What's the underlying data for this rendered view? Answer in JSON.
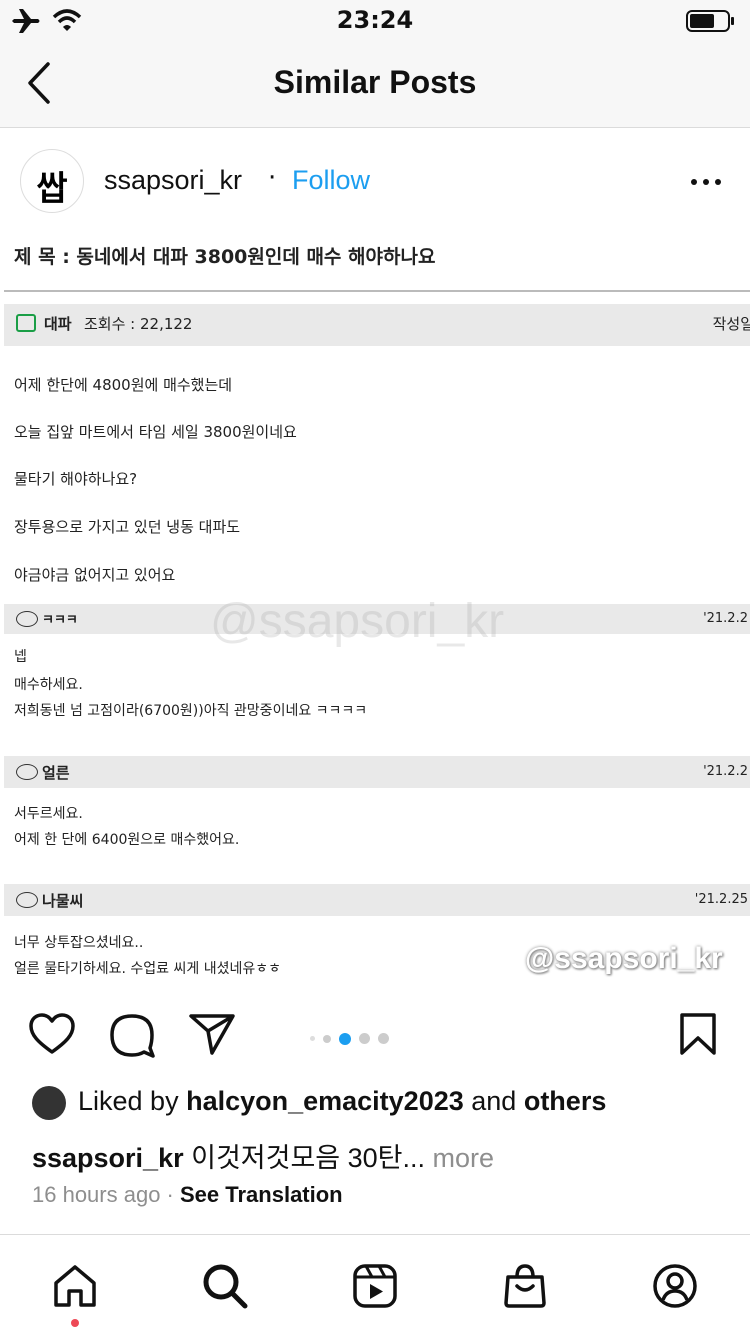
{
  "status_bar": {
    "time": "23:24"
  },
  "nav": {
    "title": "Similar Posts"
  },
  "post": {
    "avatar_text": "쌉",
    "username": "ssapsori_kr",
    "separator": "·",
    "follow": "Follow",
    "image": {
      "subject": "제 목 : 동네에서 대파 3800원인데 매수 해야하나요",
      "category": "대파",
      "views": "조회수 : 22,122",
      "written": "작성일",
      "body": [
        "어제 한단에 4800원에 매수했는데",
        "오늘 집앞 마트에서 타임 세일 3800원이네요",
        "물타기 해야하나요?",
        "장투용으로 가지고 있던 냉동 대파도",
        "야금야금 없어지고 있어요"
      ],
      "comments": [
        {
          "author": "ㅋㅋㅋ",
          "date": "'21.2.2",
          "lines": [
            "넵",
            "매수하세요.",
            "저희동넨 넘 고점이라(6700원))아직 관망중이네요 ㅋㅋㅋㅋ"
          ]
        },
        {
          "author": "얼른",
          "date": "'21.2.2",
          "lines": [
            "서두르세요.",
            "어제 한 단에 6400원으로 매수했어요."
          ]
        },
        {
          "author": "나물씨",
          "date": "'21.2.25",
          "lines": [
            "너무 상투잡으셨네요..",
            "얼른 물타기하세요. 수업료 씨게 내셨네유ㅎㅎ"
          ]
        }
      ],
      "watermark_center": "@ssapsori_kr",
      "watermark_corner": "@ssapsori_kr"
    },
    "carousel": {
      "count": 5,
      "active": 2
    },
    "likes": {
      "prefix": "Liked by ",
      "user": "halcyon_emacity2023",
      "middle": " and ",
      "others": "others"
    },
    "caption": {
      "user": "ssapsori_kr",
      "text": " 이것저것모음 30탄...",
      "more": " more"
    },
    "time_ago": "16 hours ago",
    "meta_sep": " · ",
    "see_translation": "See Translation"
  },
  "icons": [
    "airplane-icon",
    "wifi-icon",
    "battery-icon",
    "back-icon",
    "more-icon",
    "heart-icon",
    "comment-icon",
    "share-icon",
    "bookmark-icon",
    "home-icon",
    "search-icon",
    "reels-icon",
    "shop-icon",
    "profile-icon"
  ],
  "colors": {
    "accent": "#1c9ef0",
    "notification": "#ed4956"
  }
}
